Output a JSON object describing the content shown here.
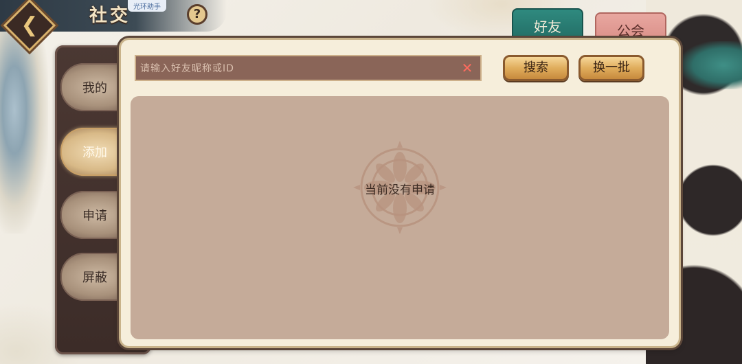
{
  "header": {
    "title": "社交",
    "assistant_badge": "光环助手",
    "back_icon": "back-arrow-icon",
    "help_icon": "question-mark-icon",
    "help_symbol": "?"
  },
  "tabs": [
    {
      "label": "好友",
      "active": true,
      "color": "#2f8a7f"
    },
    {
      "label": "公会",
      "active": false,
      "color": "#e8a7a0"
    }
  ],
  "sidebar": {
    "items": [
      {
        "label": "我的",
        "active": false
      },
      {
        "label": "添加",
        "active": true
      },
      {
        "label": "申请",
        "active": false
      },
      {
        "label": "屏蔽",
        "active": false
      }
    ]
  },
  "search": {
    "placeholder": "请输入好友昵称或ID",
    "value": "",
    "clear_icon": "close-icon",
    "clear_symbol": "✕",
    "search_label": "搜索",
    "refresh_label": "换一批"
  },
  "content": {
    "empty_message": "当前没有申请",
    "emblem_icon": "flower-emblem-icon"
  }
}
